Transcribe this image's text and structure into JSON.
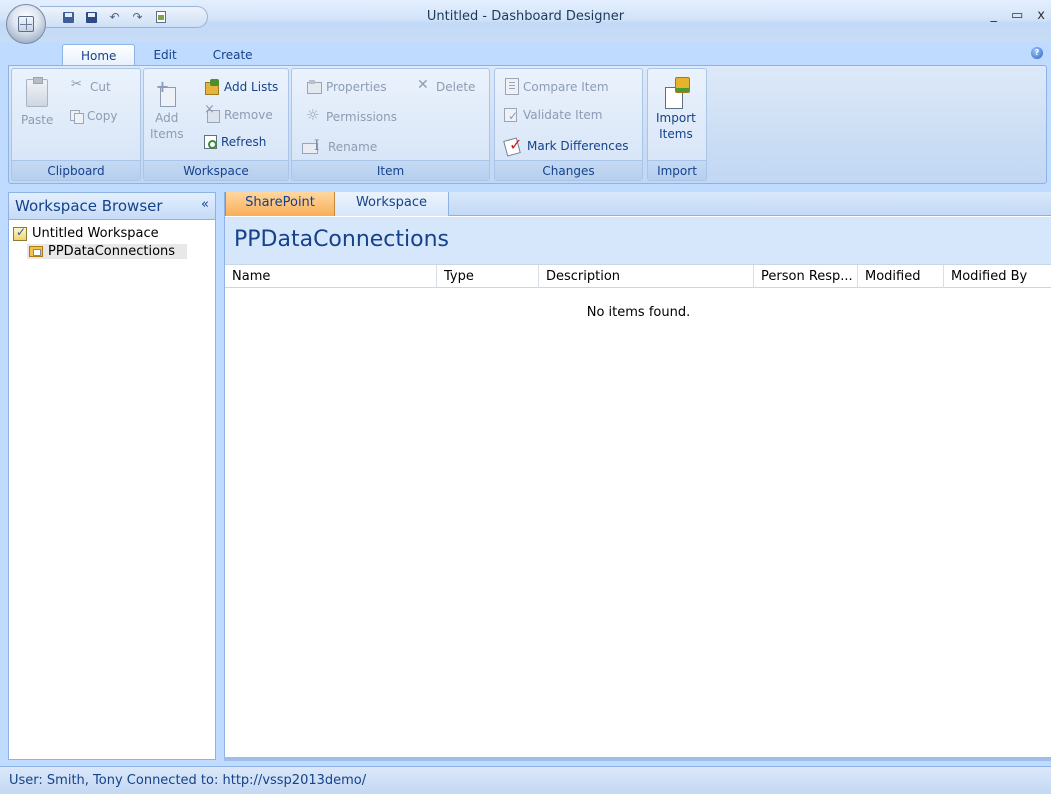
{
  "window": {
    "title": "Untitled  -  Dashboard Designer",
    "minimize": "_",
    "maximize": "▭",
    "close": "x"
  },
  "quick_access": {
    "icons": [
      "save-icon",
      "save-all-icon",
      "undo-icon",
      "redo-icon",
      "document-icon"
    ]
  },
  "ribbon_tabs": [
    {
      "label": "Home",
      "active": true
    },
    {
      "label": "Edit",
      "active": false
    },
    {
      "label": "Create",
      "active": false
    }
  ],
  "ribbon": {
    "clipboard": {
      "label": "Clipboard",
      "paste": "Paste",
      "cut": "Cut",
      "copy": "Copy"
    },
    "workspace": {
      "label": "Workspace",
      "add": "Add",
      "items": "Items",
      "add_lists": "Add Lists",
      "remove": "Remove",
      "refresh": "Refresh"
    },
    "item": {
      "label": "Item",
      "properties": "Properties",
      "permissions": "Permissions",
      "rename": "Rename",
      "delete": "Delete"
    },
    "changes": {
      "label": "Changes",
      "compare_item": "Compare Item",
      "validate_item": "Validate Item",
      "mark_differences": "Mark Differences"
    },
    "import": {
      "label": "Import",
      "import": "Import",
      "items": "Items"
    }
  },
  "workspace_browser": {
    "title": "Workspace Browser",
    "collapse": "«",
    "tree": [
      {
        "label": "Untitled Workspace",
        "icon": "workspace-icon",
        "level": 0
      },
      {
        "label": "PPDataConnections",
        "icon": "folder-icon",
        "level": 1,
        "selected": true
      }
    ]
  },
  "document_tabs": [
    {
      "label": "SharePoint",
      "active": true
    },
    {
      "label": "Workspace",
      "active": false
    }
  ],
  "panel": {
    "title": "PPDataConnections",
    "columns": [
      "Name",
      "Type",
      "Description",
      "Person Resp...",
      "Modified",
      "Modified By"
    ],
    "rows": [],
    "empty_message": "No items found."
  },
  "status": {
    "text": "User: Smith, Tony  Connected to: http://vssp2013demo/"
  },
  "colors": {
    "ribbon_text": "#15428b",
    "active_tab": "#f8ae58",
    "frame": "#bfdbff"
  }
}
